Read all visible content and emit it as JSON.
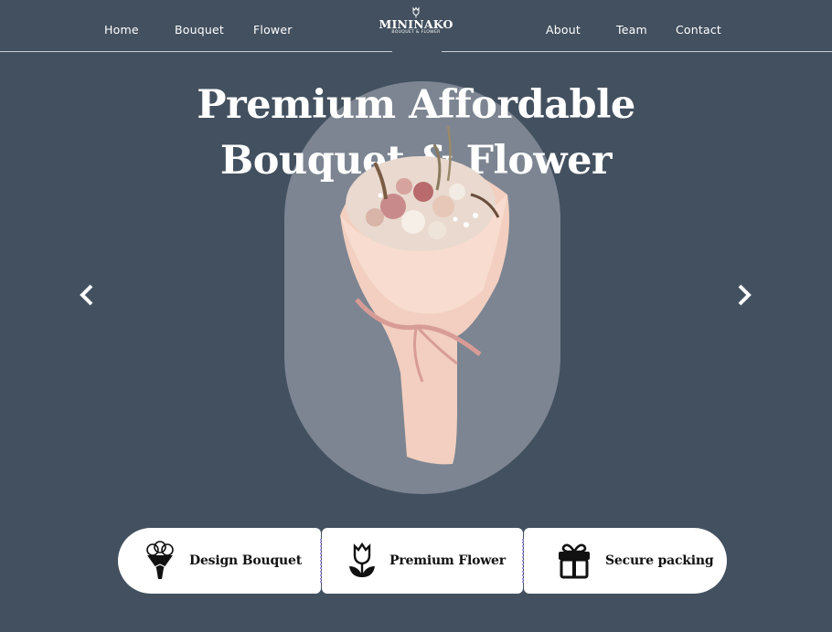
{
  "nav": {
    "left": [
      {
        "label": "Home"
      },
      {
        "label": "Bouquet"
      },
      {
        "label": "Flower"
      }
    ],
    "right": [
      {
        "label": "About"
      },
      {
        "label": "Team"
      },
      {
        "label": "Contact"
      }
    ],
    "logo": {
      "name": "MININAKO",
      "subtitle": "BOUQUET & FLOWER",
      "icon": "tulip-icon"
    }
  },
  "hero": {
    "title_line1": "Premium Affordable",
    "title_line2": "Bouquet & Flower",
    "image": "flower-bouquet-image",
    "prev_icon": "chevron-left-icon",
    "next_icon": "chevron-right-icon"
  },
  "features": [
    {
      "label": "Design Bouquet",
      "icon": "bouquet-icon"
    },
    {
      "label": "Premium Flower",
      "icon": "tulip-icon"
    },
    {
      "label": "Secure packing",
      "icon": "gift-icon"
    }
  ],
  "colors": {
    "background": "#43505f",
    "hero_pill": "#7c8591",
    "card": "#ffffff",
    "divider": "#9b8ed6",
    "text_light": "#ffffff",
    "text_dark": "#111111"
  }
}
